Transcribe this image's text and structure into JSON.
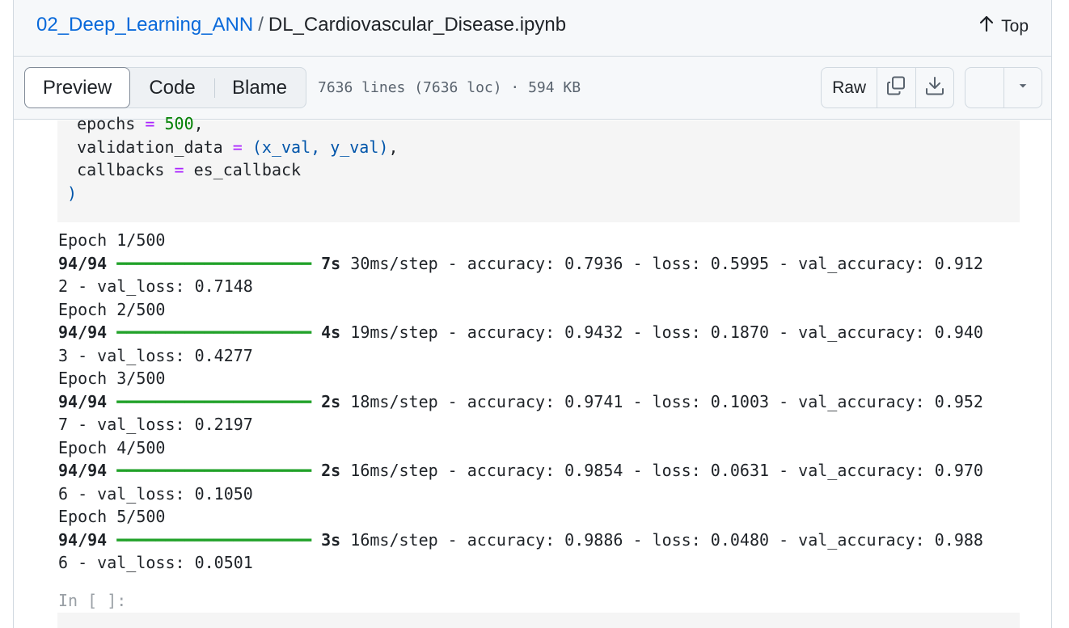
{
  "breadcrumb": {
    "repo": "02_Deep_Learning_ANN",
    "separator": "/",
    "file": "DL_Cardiovascular_Disease.ipynb"
  },
  "header": {
    "top_label": "Top",
    "top_icon": "arrow-up-icon"
  },
  "toolbar": {
    "tabs": [
      "Preview",
      "Code",
      "Blame"
    ],
    "active_tab": "Preview",
    "meta": "7636 lines (7636 loc) · 594 KB",
    "raw_label": "Raw",
    "icons": [
      "copy-icon",
      "download-icon",
      "pencil-icon",
      "triangle-down-icon"
    ]
  },
  "code_cell": {
    "lines": [
      {
        "indent": "  ",
        "name": "epochs",
        "op": "=",
        "value": "500",
        "trail": ","
      },
      {
        "indent": "  ",
        "name": "validation_data",
        "op": "=",
        "value": "(x_val, y_val)",
        "trail": ","
      },
      {
        "indent": "  ",
        "name": "callbacks",
        "op": "=",
        "value": "es_callback",
        "trail": ""
      },
      {
        "indent": "",
        "name": "",
        "op": "",
        "value": ")",
        "trail": ""
      }
    ]
  },
  "output": {
    "epochs": [
      {
        "epoch": "Epoch 1/500",
        "steps": "94/94",
        "bar": "━━━━━━━━━━━━━━━━━━━━",
        "time": "7s",
        "rest": " 30ms/step - accuracy: 0.7936 - loss: 0.5995 - val_accuracy: 0.912",
        "wrap": "2 - val_loss: 0.7148"
      },
      {
        "epoch": "Epoch 2/500",
        "steps": "94/94",
        "bar": "━━━━━━━━━━━━━━━━━━━━",
        "time": "4s",
        "rest": " 19ms/step - accuracy: 0.9432 - loss: 0.1870 - val_accuracy: 0.940",
        "wrap": "3 - val_loss: 0.4277"
      },
      {
        "epoch": "Epoch 3/500",
        "steps": "94/94",
        "bar": "━━━━━━━━━━━━━━━━━━━━",
        "time": "2s",
        "rest": " 18ms/step - accuracy: 0.9741 - loss: 0.1003 - val_accuracy: 0.952",
        "wrap": "7 - val_loss: 0.2197"
      },
      {
        "epoch": "Epoch 4/500",
        "steps": "94/94",
        "bar": "━━━━━━━━━━━━━━━━━━━━",
        "time": "2s",
        "rest": " 16ms/step - accuracy: 0.9854 - loss: 0.0631 - val_accuracy: 0.970",
        "wrap": "6 - val_loss: 0.1050"
      },
      {
        "epoch": "Epoch 5/500",
        "steps": "94/94",
        "bar": "━━━━━━━━━━━━━━━━━━━━",
        "time": "3s",
        "rest": " 16ms/step - accuracy: 0.9886 - loss: 0.0480 - val_accuracy: 0.988",
        "wrap": "6 - val_loss: 0.0501"
      }
    ]
  },
  "next_cell": {
    "prompt": "In [ ]:"
  },
  "colors": {
    "link": "#0969da",
    "progress_bar": "#22a22a",
    "operator": "#aa22ff",
    "number": "#008000"
  }
}
